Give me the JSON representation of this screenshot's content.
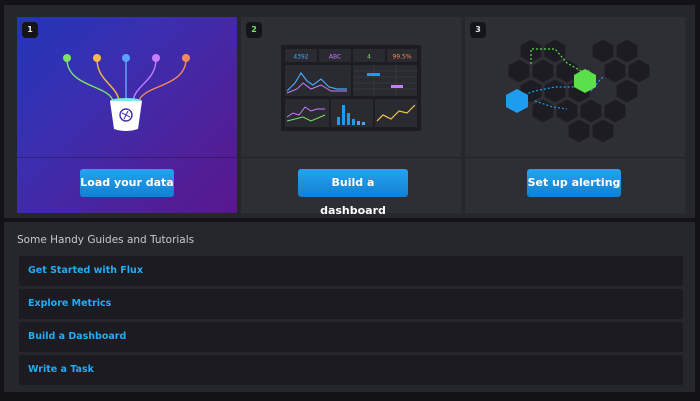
{
  "cards": [
    {
      "number": "1",
      "button_label": "Load your data",
      "illustration": "bucket-icon"
    },
    {
      "number": "2",
      "button_label": "Build a dashboard",
      "illustration": "dashboard-icon",
      "dashboard_stats": [
        "4392",
        "ABC",
        "4",
        "99.5%"
      ]
    },
    {
      "number": "3",
      "button_label": "Set up alerting",
      "illustration": "hexagon-alert-icon"
    }
  ],
  "guides": {
    "title": "Some Handy Guides and Tutorials",
    "links": [
      {
        "label": "Get Started with Flux"
      },
      {
        "label": "Explore Metrics"
      },
      {
        "label": "Build a Dashboard"
      },
      {
        "label": "Write a Task"
      }
    ]
  },
  "colors": {
    "accent_blue": "#22adf6",
    "button_blue": "#1b8fe2",
    "step_green": "#6fe65c",
    "alert_green": "#5ce04a",
    "alert_blue": "#1e9cf0"
  }
}
